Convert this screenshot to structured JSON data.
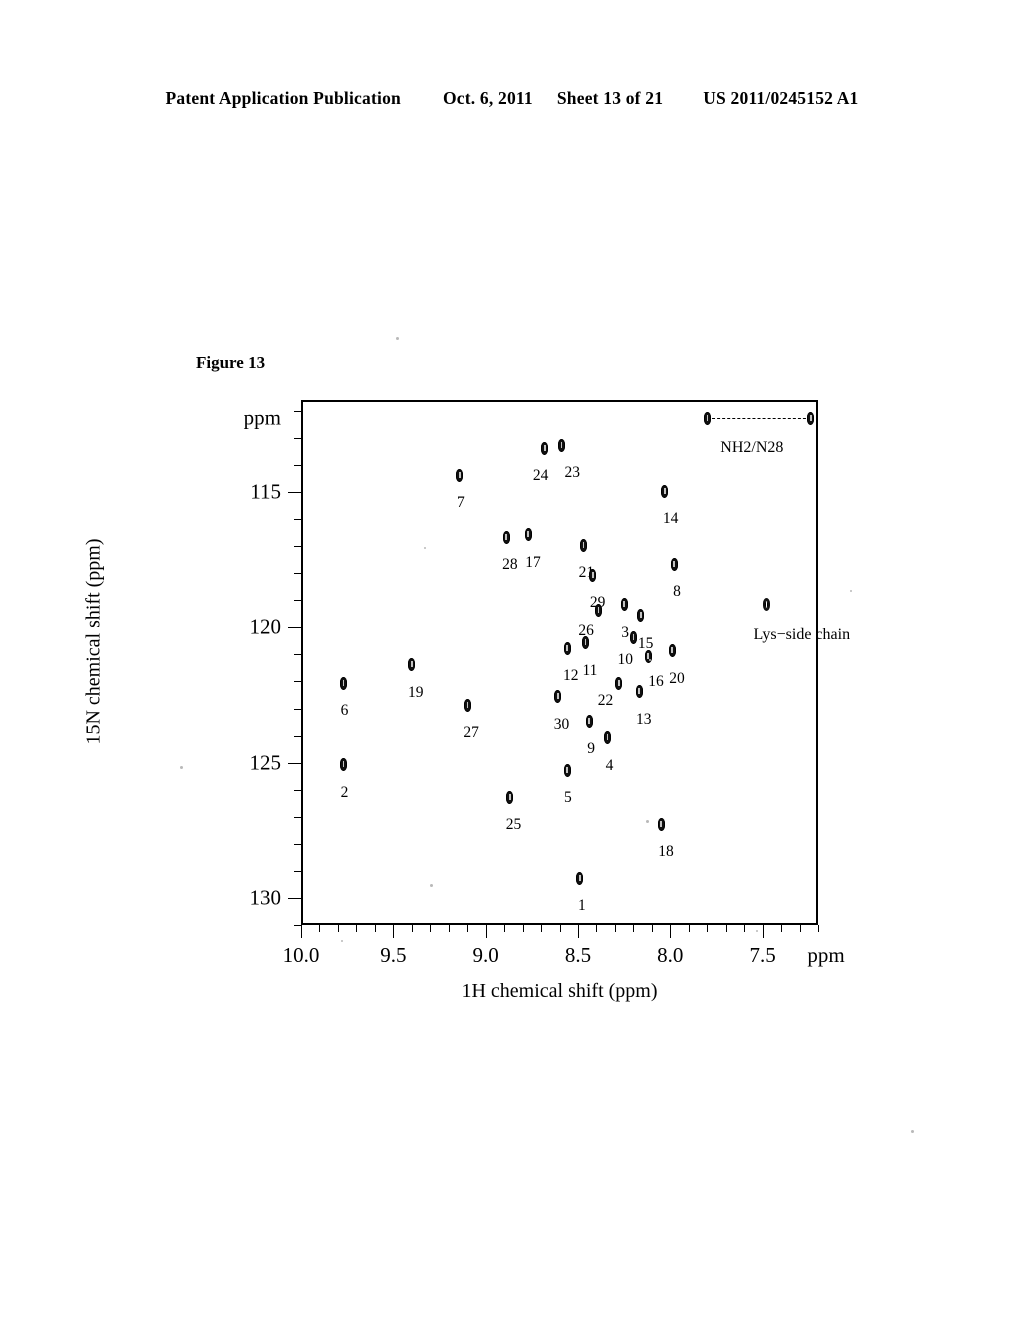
{
  "header": {
    "publication": "Patent Application Publication",
    "date": "Oct. 6, 2011",
    "sheet": "Sheet 13 of 21",
    "patent_number": "US 2011/0245152 A1"
  },
  "figure": {
    "caption": "Figure 13"
  },
  "chart_data": {
    "type": "scatter",
    "title": "Figure 13",
    "xlabel": "1H chemical shift (ppm)",
    "ylabel": "15N chemical shift (ppm)",
    "x_unit_label": "ppm",
    "y_unit_label": "ppm",
    "xlim": [
      10.0,
      7.2
    ],
    "ylim": [
      111.6,
      131.0
    ],
    "x_inverted": true,
    "y_inverted": true,
    "grid": false,
    "legend": "none",
    "xticks": [
      10.0,
      9.5,
      9.0,
      8.5,
      8.0,
      7.5
    ],
    "xtick_labels": [
      "10.0",
      "9.5",
      "9.0",
      "8.5",
      "8.0",
      "7.5"
    ],
    "yticks": [
      115,
      120,
      125,
      130
    ],
    "ytick_labels": [
      "115",
      "120",
      "125",
      "130"
    ],
    "x_minor_step": 0.1,
    "y_minor_step": 1,
    "points": [
      {
        "label": "24",
        "x": 8.69,
        "y": 113.3,
        "label_dx": -12,
        "label_dy": 20,
        "style": "filled"
      },
      {
        "label": "23",
        "x": 8.6,
        "y": 113.2,
        "label_dx": 3,
        "label_dy": 20,
        "style": "filled"
      },
      {
        "label": "7",
        "x": 9.15,
        "y": 114.3,
        "label_dx": -3,
        "label_dy": 20,
        "style": "filled"
      },
      {
        "label": "14",
        "x": 8.04,
        "y": 114.9,
        "label_dx": -2,
        "label_dy": 20,
        "style": "filled"
      },
      {
        "label": "28",
        "x": 8.9,
        "y": 116.6,
        "label_dx": -4,
        "label_dy": 20,
        "style": "filled"
      },
      {
        "label": "17",
        "x": 8.78,
        "y": 116.5,
        "label_dx": -3,
        "label_dy": 20,
        "style": "filled"
      },
      {
        "label": "21",
        "x": 8.48,
        "y": 116.9,
        "label_dx": -5,
        "label_dy": 20,
        "style": "filled"
      },
      {
        "label": "29",
        "x": 8.43,
        "y": 118.0,
        "label_dx": -3,
        "label_dy": 20,
        "style": "filled"
      },
      {
        "label": "8",
        "x": 7.99,
        "y": 117.6,
        "label_dx": -1,
        "label_dy": 20,
        "style": "filled"
      },
      {
        "label": "26",
        "x": 8.4,
        "y": 119.3,
        "label_dx": -20,
        "label_dy": 13,
        "style": "filled"
      },
      {
        "label": "3",
        "x": 8.26,
        "y": 119.1,
        "label_dx": -3,
        "label_dy": 20,
        "style": "filled"
      },
      {
        "label": "15",
        "x": 8.17,
        "y": 119.5,
        "label_dx": -3,
        "label_dy": 20,
        "style": "filled"
      },
      {
        "label": "19",
        "x": 9.41,
        "y": 121.3,
        "label_dx": -4,
        "label_dy": 20,
        "style": "filled"
      },
      {
        "label": "6",
        "x": 9.78,
        "y": 122.0,
        "label_dx": -3,
        "label_dy": 20,
        "style": "filled"
      },
      {
        "label": "12",
        "x": 8.57,
        "y": 120.7,
        "label_dx": -4,
        "label_dy": 20,
        "style": "filled"
      },
      {
        "label": "11",
        "x": 8.47,
        "y": 120.5,
        "label_dx": -3,
        "label_dy": 20,
        "style": "filled"
      },
      {
        "label": "10",
        "x": 8.21,
        "y": 120.3,
        "label_dx": -16,
        "label_dy": 15,
        "style": "filled"
      },
      {
        "label": "16",
        "x": 8.13,
        "y": 121.0,
        "label_dx": 0,
        "label_dy": 18,
        "style": "filled"
      },
      {
        "label": "20",
        "x": 8.0,
        "y": 120.8,
        "label_dx": -3,
        "label_dy": 20,
        "style": "filled"
      },
      {
        "label": "22",
        "x": 8.29,
        "y": 122.0,
        "label_dx": -21,
        "label_dy": 10,
        "style": "filled"
      },
      {
        "label": "13",
        "x": 8.18,
        "y": 122.3,
        "label_dx": -3,
        "label_dy": 20,
        "style": "filled"
      },
      {
        "label": "27",
        "x": 9.11,
        "y": 122.8,
        "label_dx": -4,
        "label_dy": 20,
        "style": "filled"
      },
      {
        "label": "30",
        "x": 8.62,
        "y": 122.5,
        "label_dx": -4,
        "label_dy": 20,
        "style": "filled"
      },
      {
        "label": "9",
        "x": 8.45,
        "y": 123.4,
        "label_dx": -2,
        "label_dy": 20,
        "style": "filled"
      },
      {
        "label": "4",
        "x": 8.35,
        "y": 124.0,
        "label_dx": -2,
        "label_dy": 20,
        "style": "filled"
      },
      {
        "label": "2",
        "x": 9.78,
        "y": 125.0,
        "label_dx": -3,
        "label_dy": 20,
        "style": "filled"
      },
      {
        "label": "5",
        "x": 8.57,
        "y": 125.2,
        "label_dx": -3,
        "label_dy": 20,
        "style": "filled"
      },
      {
        "label": "25",
        "x": 8.88,
        "y": 126.2,
        "label_dx": -4,
        "label_dy": 20,
        "style": "filled"
      },
      {
        "label": "18",
        "x": 8.06,
        "y": 127.2,
        "label_dx": -3,
        "label_dy": 20,
        "style": "filled"
      },
      {
        "label": "1",
        "x": 8.5,
        "y": 129.2,
        "label_dx": -2,
        "label_dy": 20,
        "style": "filled"
      }
    ],
    "unnumbered_points": [
      {
        "name": "nh2-left",
        "x": 7.81,
        "y": 112.2,
        "style": "filled"
      },
      {
        "name": "nh2-right",
        "x": 7.25,
        "y": 112.2,
        "style": "filled"
      },
      {
        "name": "lys-side-chain",
        "x": 7.49,
        "y": 119.1,
        "style": "hollow"
      }
    ],
    "annotations": [
      {
        "name": "nh2-n28-label",
        "text": "NH2/N28",
        "x": 7.74,
        "y": 113.0
      },
      {
        "name": "lys-side-chain-label",
        "text": "Lys−side chain",
        "x": 7.56,
        "y": 119.9
      }
    ],
    "connectors": [
      {
        "name": "nh2-n28-connector",
        "from_x": 7.81,
        "from_y": 112.2,
        "to_x": 7.25,
        "to_y": 112.2,
        "style": "dashed"
      }
    ]
  }
}
